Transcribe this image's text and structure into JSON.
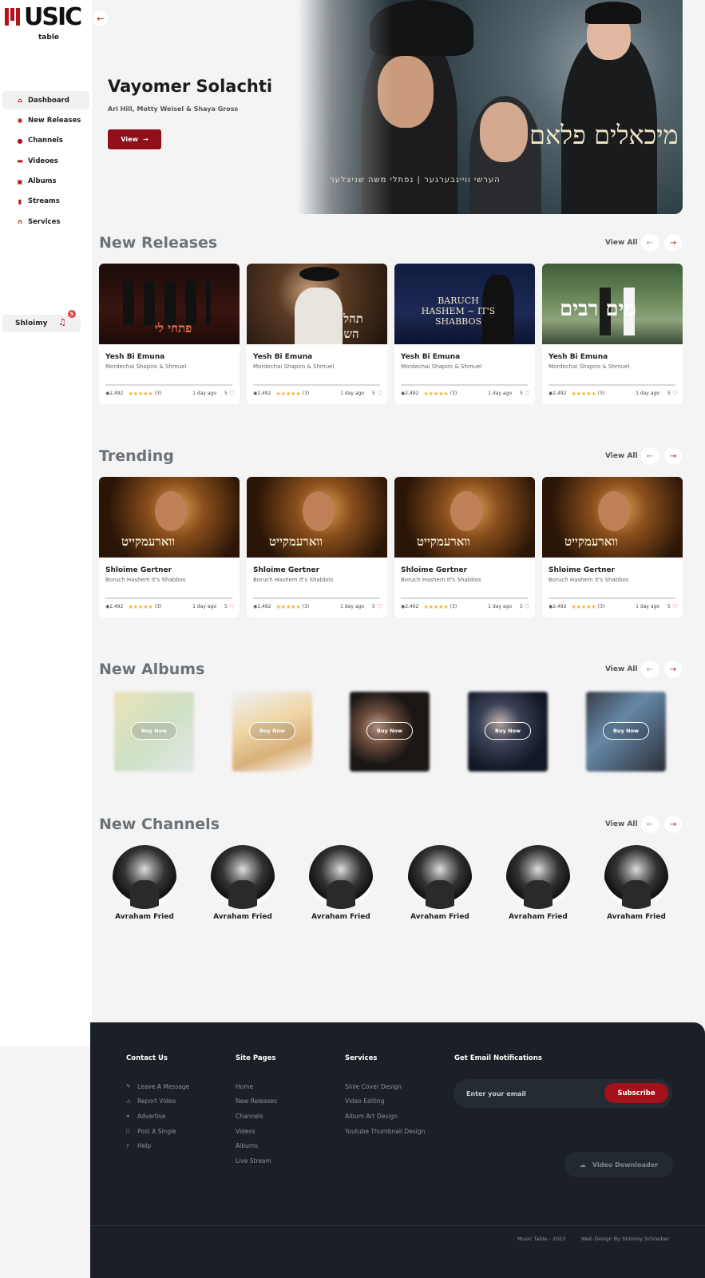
{
  "logo": {
    "word": "USIC",
    "sub": "table"
  },
  "sidebar": {
    "items": [
      {
        "label": "Dashboard",
        "icon": "home-icon"
      },
      {
        "label": "New Releases",
        "icon": "new-releases-icon"
      },
      {
        "label": "Channels",
        "icon": "channels-icon"
      },
      {
        "label": "Videoes",
        "icon": "video-icon"
      },
      {
        "label": "Albums",
        "icon": "album-icon"
      },
      {
        "label": "Streams",
        "icon": "stream-icon"
      },
      {
        "label": "Services",
        "icon": "headphones-icon"
      }
    ],
    "user": {
      "name": "Shloimy",
      "notifications": "5"
    }
  },
  "hero": {
    "title": "Vayomer Solachti",
    "subtitle": "Ari Hill, Motty Weisel & Shaya Gross",
    "button": "View",
    "hebrew_title": "מיכאלים פלאם",
    "hebrew_credit": "הערשי וויינבערגער | נפתלי משה שניצלער"
  },
  "new_releases": {
    "title": "New Releases",
    "view_all": "View All",
    "cards": [
      {
        "title": "Yesh Bi Emuna",
        "artist": "Mordechai Shapiro & Shmuel",
        "views": "2,492",
        "rating_count": "(3)",
        "ago": "1 day ago",
        "likes": "5",
        "overlay": "פתחי לי"
      },
      {
        "title": "Yesh Bi Emuna",
        "artist": "Mordechai Shapiro & Shmuel",
        "views": "2,492",
        "rating_count": "(3)",
        "ago": "1 day ago",
        "likes": "5",
        "overlay": "תהלת השם"
      },
      {
        "title": "Yesh Bi Emuna",
        "artist": "Mordechai Shapiro & Shmuel",
        "views": "2,492",
        "rating_count": "(3)",
        "ago": "1 day ago",
        "likes": "5",
        "overlay": "BARUCH HASHEM ~ IT'S SHABBOS"
      },
      {
        "title": "Yesh Bi Emuna",
        "artist": "Mordechai Shapiro & Shmuel",
        "views": "2,492",
        "rating_count": "(3)",
        "ago": "1 day ago",
        "likes": "5",
        "overlay": "מים רבים"
      }
    ]
  },
  "trending": {
    "title": "Trending",
    "view_all": "View All",
    "cards": [
      {
        "title": "Shloime Gertner",
        "artist": "Boruch Hashem It's Shabbos",
        "views": "2,492",
        "rating_count": "(3)",
        "ago": "1 day ago",
        "likes": "5",
        "overlay": "ווארעמקייט"
      },
      {
        "title": "Shloime Gertner",
        "artist": "Boruch Hashem It's Shabbos",
        "views": "2,492",
        "rating_count": "(3)",
        "ago": "1 day ago",
        "likes": "5",
        "overlay": "ווארעמקייט"
      },
      {
        "title": "Shloime Gertner",
        "artist": "Boruch Hashem It's Shabbos",
        "views": "2,492",
        "rating_count": "(3)",
        "ago": "1 day ago",
        "likes": "5",
        "overlay": "ווארעמקייט"
      },
      {
        "title": "Shloime Gertner",
        "artist": "Boruch Hashem It's Shabbos",
        "views": "2,492",
        "rating_count": "(3)",
        "ago": "1 day ago",
        "likes": "5",
        "overlay": "ווארעמקייט"
      }
    ]
  },
  "new_albums": {
    "title": "New Albums",
    "view_all": "View All",
    "buy_label": "Buy Now"
  },
  "new_channels": {
    "title": "New Channels",
    "view_all": "View All",
    "names": [
      "Avraham Fried",
      "Avraham Fried",
      "Avraham Fried",
      "Avraham Fried",
      "Avraham Fried",
      "Avraham Fried"
    ]
  },
  "footer": {
    "contact": {
      "title": "Contact Us",
      "links": [
        {
          "label": "Leave A Message",
          "icon": "edit-icon"
        },
        {
          "label": "Report Video",
          "icon": "warning-icon"
        },
        {
          "label": "Advertise",
          "icon": "megaphone-icon"
        },
        {
          "label": "Post A Single",
          "icon": "document-icon"
        },
        {
          "label": "Help",
          "icon": "help-icon"
        }
      ]
    },
    "site_pages": {
      "title": "Site Pages",
      "links": [
        "Home",
        "New Releases",
        "Channels",
        "Videos",
        "Albums",
        "Live Stream"
      ]
    },
    "services": {
      "title": "Services",
      "links": [
        "Sinle Cover Design",
        "Video Editing",
        "Album Art Design",
        "Youtube Thumbnail Design"
      ]
    },
    "notifications": {
      "title": "Get Email Notifications",
      "placeholder": "Enter your email",
      "button": "Subscribe"
    },
    "downloader": "Video Downloader",
    "copyright": "Music Table - 2023",
    "credit": "Web Design By Shloimy Schreiber"
  },
  "colors": {
    "accent": "#8f1018",
    "footer_bg": "#1b2027",
    "star": "#f0b429"
  }
}
